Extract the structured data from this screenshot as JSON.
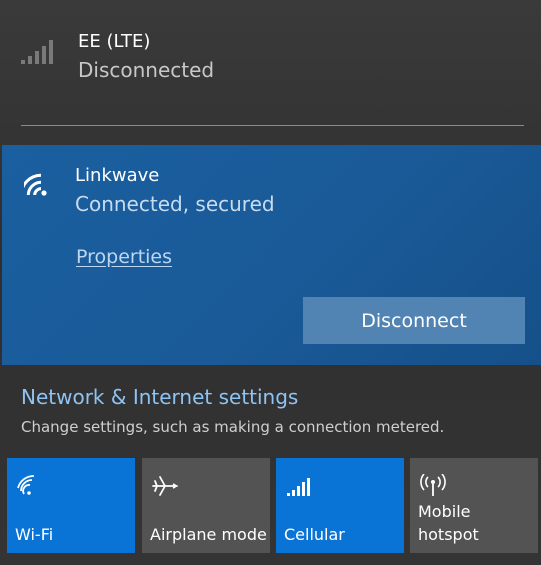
{
  "cellular": {
    "name": "EE (LTE)",
    "status": "Disconnected",
    "icon": "cellular-signal-icon"
  },
  "wifi": {
    "name": "Linkwave",
    "status": "Connected, secured",
    "properties_label": "Properties",
    "disconnect_label": "Disconnect",
    "icon": "wifi-icon"
  },
  "settings": {
    "link_label": "Network & Internet settings",
    "description": "Change settings, such as making a connection metered."
  },
  "quick_actions": [
    {
      "label": "Wi-Fi",
      "state": "on",
      "icon": "wifi-icon"
    },
    {
      "label": "Airplane mode",
      "state": "off",
      "icon": "airplane-icon"
    },
    {
      "label": "Cellular",
      "state": "on",
      "icon": "cellular-signal-icon"
    },
    {
      "label": "Mobile hotspot",
      "state": "off",
      "icon": "mobile-hotspot-icon"
    }
  ],
  "colors": {
    "accent": "#0a74d6",
    "selected_bg": "#1a5fa0",
    "link": "#8fc3f2",
    "tile_off": "#535353"
  }
}
